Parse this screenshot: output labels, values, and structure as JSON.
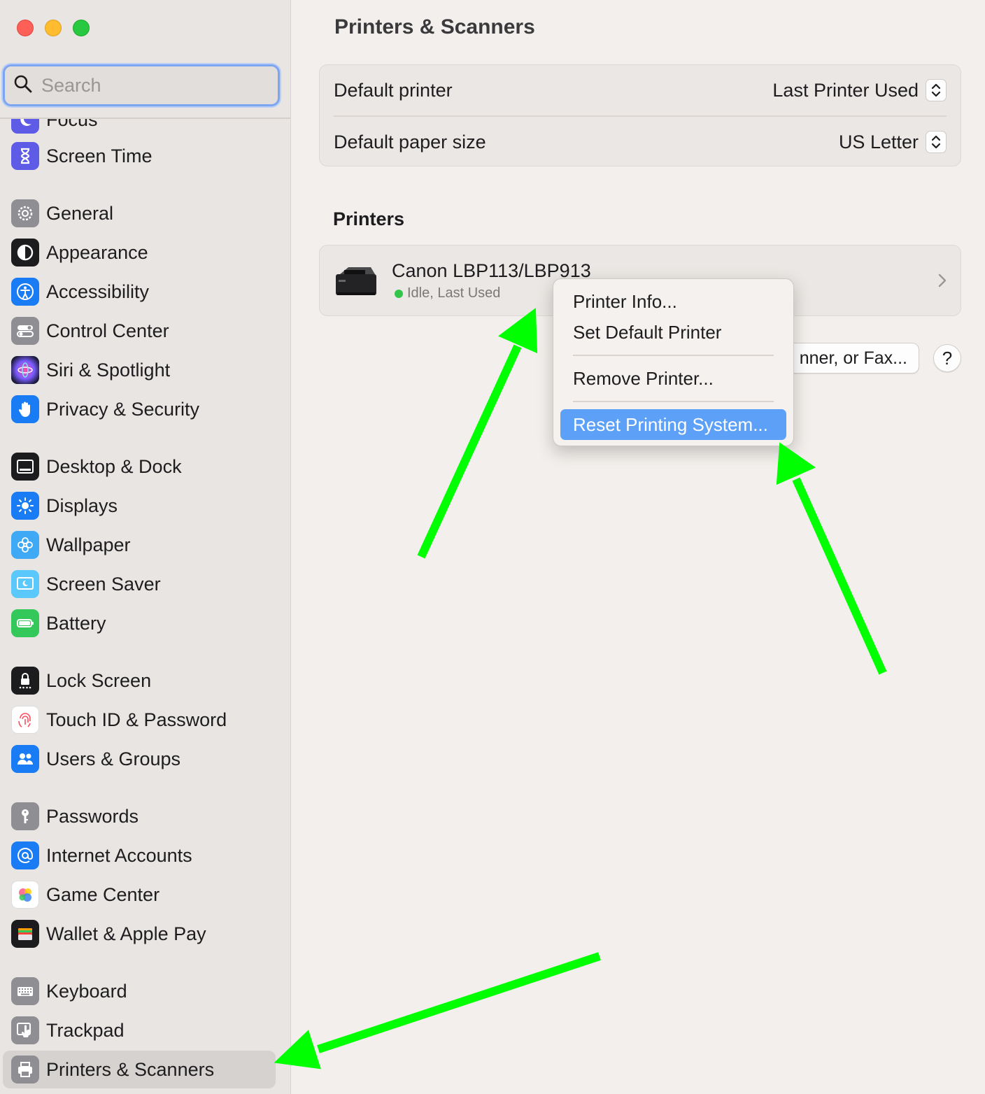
{
  "window": {
    "title": "Printers & Scanners"
  },
  "search": {
    "placeholder": "Search",
    "icon": "magnifier-icon"
  },
  "sidebar": {
    "items": [
      {
        "label": "Focus",
        "icon": "moon-icon",
        "color": "#5e5ce6"
      },
      {
        "label": "Screen Time",
        "icon": "hourglass-icon",
        "color": "#5e5ce6"
      },
      {
        "label": "General",
        "icon": "gear-icon",
        "color": "#8e8e93"
      },
      {
        "label": "Appearance",
        "icon": "appearance-icon",
        "color": "#1c1c1e"
      },
      {
        "label": "Accessibility",
        "icon": "accessibility-icon",
        "color": "#1a7cf5"
      },
      {
        "label": "Control Center",
        "icon": "toggles-icon",
        "color": "#8e8e93"
      },
      {
        "label": "Siri & Spotlight",
        "icon": "siri-icon",
        "color": "#2b2b60"
      },
      {
        "label": "Privacy & Security",
        "icon": "hand-icon",
        "color": "#1a7cf5"
      },
      {
        "label": "Desktop & Dock",
        "icon": "dock-icon",
        "color": "#1c1c1e"
      },
      {
        "label": "Displays",
        "icon": "sun-icon",
        "color": "#1a7cf5"
      },
      {
        "label": "Wallpaper",
        "icon": "flower-icon",
        "color": "#3fa9f5"
      },
      {
        "label": "Screen Saver",
        "icon": "screensaver-icon",
        "color": "#5ac8fa"
      },
      {
        "label": "Battery",
        "icon": "battery-icon",
        "color": "#34c759"
      },
      {
        "label": "Lock Screen",
        "icon": "lock-icon",
        "color": "#1c1c1e"
      },
      {
        "label": "Touch ID & Password",
        "icon": "fingerprint-icon",
        "color": "#ffffff"
      },
      {
        "label": "Users & Groups",
        "icon": "users-icon",
        "color": "#1a7cf5"
      },
      {
        "label": "Passwords",
        "icon": "key-icon",
        "color": "#8e8e93"
      },
      {
        "label": "Internet Accounts",
        "icon": "at-icon",
        "color": "#1a7cf5"
      },
      {
        "label": "Game Center",
        "icon": "game-center-icon",
        "color": "#ffffff"
      },
      {
        "label": "Wallet & Apple Pay",
        "icon": "wallet-icon",
        "color": "#1c1c1e"
      },
      {
        "label": "Keyboard",
        "icon": "keyboard-icon",
        "color": "#8e8e93"
      },
      {
        "label": "Trackpad",
        "icon": "trackpad-icon",
        "color": "#8e8e93"
      },
      {
        "label": "Printers & Scanners",
        "icon": "printer-icon",
        "color": "#8e8e93",
        "selected": true
      }
    ]
  },
  "main": {
    "title": "Printers & Scanners",
    "settings": {
      "default_printer_label": "Default printer",
      "default_printer_value": "Last Printer Used",
      "paper_size_label": "Default paper size",
      "paper_size_value": "US Letter"
    },
    "printers_title": "Printers",
    "printer": {
      "name": "Canon LBP113/LBP913",
      "status": "Idle, Last Used",
      "status_color": "#33c54a"
    },
    "add_button_label": "nner, or Fax...",
    "help_label": "?"
  },
  "context_menu": {
    "items": [
      "Printer Info...",
      "Set Default Printer",
      "Remove Printer...",
      "Reset Printing System..."
    ],
    "highlighted": "Reset Printing System...",
    "highlight_color": "#5ca0f7"
  },
  "annotations": {
    "arrow_color": "#00ff00"
  }
}
